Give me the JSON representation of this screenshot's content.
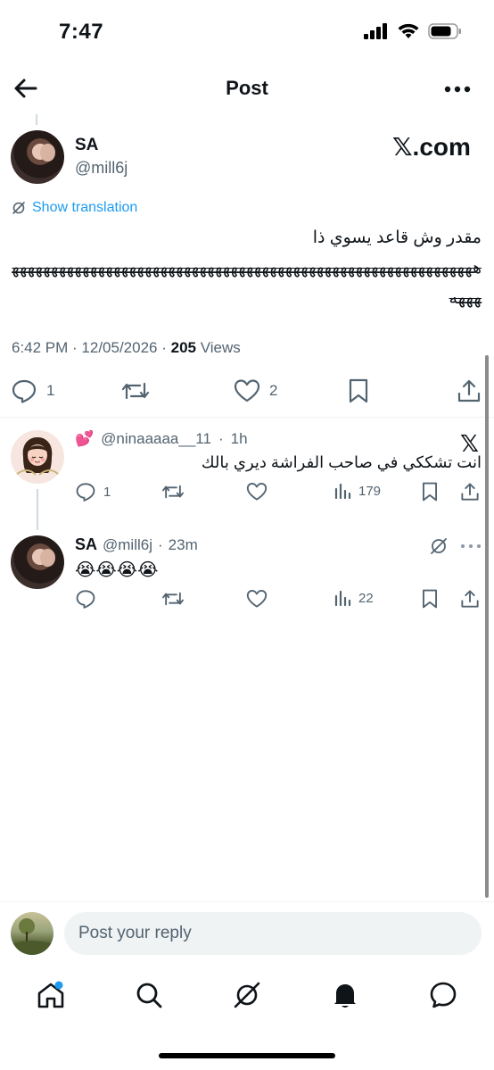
{
  "status": {
    "time": "7:47"
  },
  "header": {
    "title": "Post"
  },
  "post": {
    "author_name": "SA",
    "author_handle": "@mill6j",
    "brand": "𝕏.com",
    "show_translation": "Show translation",
    "text_line1": "مقدر وش قاعد يسوي ذا",
    "text_laugh": "هههههههههههههههههههههههههههههههههههههههههههههههههههههههههههههههه",
    "time": "6:42 PM",
    "date": "12/05/2026",
    "views_count": "205",
    "views_label": "Views",
    "replies": "1",
    "likes": "2"
  },
  "replies": [
    {
      "emoji": "💕",
      "handle": "@ninaaaaa__11",
      "age": "1h",
      "text": "انت تشككي في صاحب الفراشة ديري بالك",
      "replies": "1",
      "views": "179"
    },
    {
      "name": "SA",
      "handle": "@mill6j",
      "age": "23m",
      "text": "😭😭😭😭",
      "views": "22"
    }
  ],
  "reply_box": {
    "placeholder": "Post your reply"
  },
  "colors": {
    "accent": "#1d9bf0",
    "muted": "#536471",
    "text": "#0f1419"
  }
}
